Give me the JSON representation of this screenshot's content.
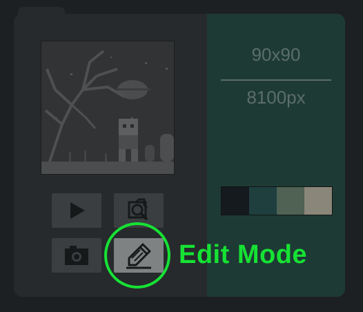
{
  "canvas": {
    "dimensions": "90x90",
    "pixel_count": "8100px"
  },
  "palette": [
    {
      "name": "swatch-1",
      "color": "#151a1e"
    },
    {
      "name": "swatch-2",
      "color": "#1f3f3f"
    },
    {
      "name": "swatch-3",
      "color": "#4f6254"
    },
    {
      "name": "swatch-4",
      "color": "#8a8679"
    }
  ],
  "toolbar": {
    "play_icon": "play-icon",
    "zoom_icon": "zoom-inspect-icon",
    "camera_icon": "camera-icon",
    "edit_icon": "pencil-icon"
  },
  "annotation": {
    "label": "Edit Mode",
    "color": "#16e234"
  }
}
